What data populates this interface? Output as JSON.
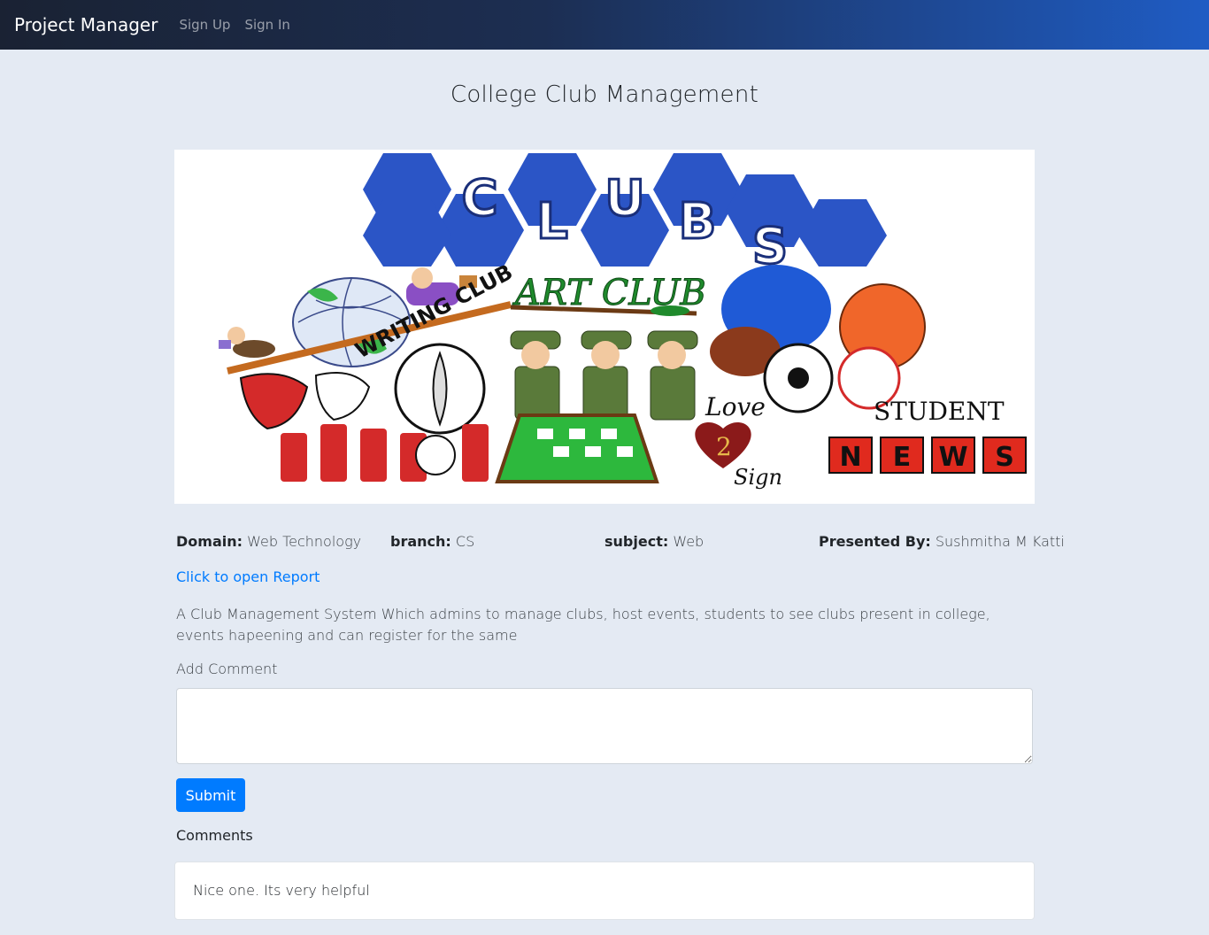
{
  "navbar": {
    "brand": "Project Manager",
    "links": [
      "Sign Up",
      "Sign In"
    ]
  },
  "page": {
    "title": "College Club Management"
  },
  "banner": {
    "clubs_letters": [
      "C",
      "L",
      "U",
      "B",
      "S"
    ],
    "art_club": "ART CLUB",
    "writing_club": "WRITING CLUB",
    "love_sign": [
      "Love",
      "2",
      "Sign"
    ],
    "student_news": "STUDENT",
    "news_letters": [
      "N",
      "E",
      "W",
      "S"
    ],
    "colors": {
      "hexagon": "#2b55c6",
      "art_green": "#1f8a2c",
      "news_red": "#e02a1e"
    }
  },
  "project": {
    "domain_label": "Domain:",
    "domain_value": "Web Technology",
    "branch_label": "branch:",
    "branch_value": "CS",
    "subject_label": "subject:",
    "subject_value": "Web",
    "presenter_label": "Presented By:",
    "presenter_value": "Sushmitha M Katti",
    "report_link": "Click to open Report",
    "description": "A Club Management System Which admins to manage clubs, host events, students to see clubs present in college, events hapeening and can register for the same"
  },
  "comment_form": {
    "label": "Add Comment",
    "value": "",
    "submit_label": "Submit"
  },
  "comments": {
    "heading": "Comments",
    "items": [
      "Nice one. Its very helpful"
    ]
  }
}
